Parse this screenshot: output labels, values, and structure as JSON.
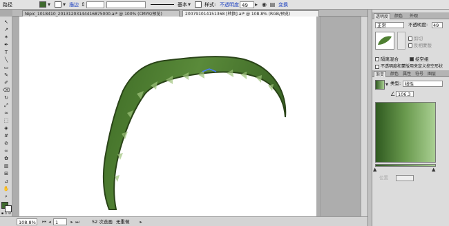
{
  "control_bar": {
    "selection_label": "路径",
    "stroke_label": "描边",
    "stroke_weight": "",
    "brush_label": "基本",
    "style_label": "样式:",
    "opacity_label": "不透明度",
    "opacity_value": "49",
    "transform_label": "变换",
    "fill_color": "#3f6a2e",
    "stroke_color": "#ffffff"
  },
  "document_tabs": [
    {
      "label": "Nipic_1018410_20131203144416875000.ai* @ 100% (CMYK/预览)"
    },
    {
      "label": "200791014151368 [转换].ai* @ 108.8% (RGB/预览)"
    }
  ],
  "status_bar": {
    "zoom": "108.8%",
    "page": "1",
    "info": "52 次迭画",
    "selection": "无重做"
  },
  "panels": {
    "transparency": {
      "tabs": [
        "透明度",
        "颜色",
        "外观"
      ],
      "blend_mode": "正常",
      "opacity_label": "不透明度:",
      "opacity_value": "49",
      "clip_label": "剪切",
      "invert_label": "反相蒙版",
      "isolate_label": "隔离混合",
      "knockout_label": "挖空组",
      "opacity_mask_label": "不透明度和蒙版用来定义挖空形状"
    },
    "gradient": {
      "tabs": [
        "渐变",
        "颜色",
        "属性",
        "符号",
        "图层"
      ],
      "type_label": "类型:",
      "type_value": "线性",
      "angle_value": "106.3",
      "position_label": "位置",
      "stop_left": "#2f5a20",
      "stop_right": "#a9cf92"
    }
  }
}
